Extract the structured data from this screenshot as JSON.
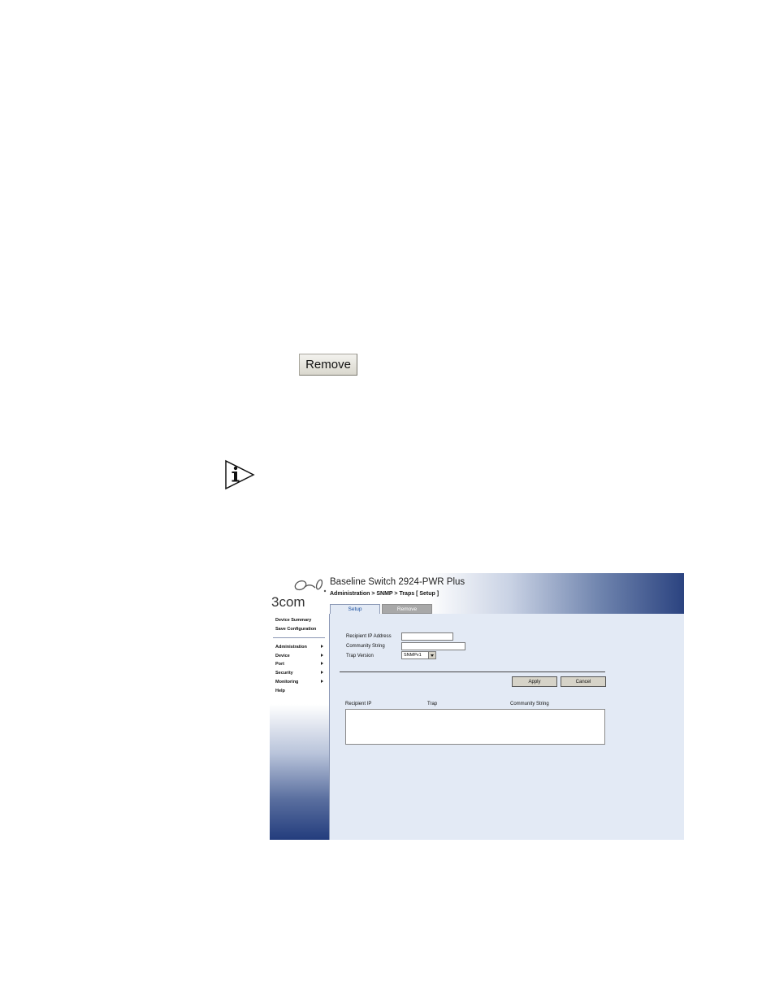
{
  "document": {
    "remove_button_label": "Remove"
  },
  "screenshot": {
    "logo_text": "3com",
    "app_title": "Baseline Switch 2924-PWR Plus",
    "breadcrumb": "Administration > SNMP > Traps [ Setup ]",
    "tabs": [
      {
        "label": "Setup",
        "active": true
      },
      {
        "label": "Remove",
        "active": false
      }
    ],
    "sidebar": {
      "top_links": [
        "Device Summary",
        "Save Configuration"
      ],
      "menu": [
        {
          "label": "Administration",
          "has_submenu": true
        },
        {
          "label": "Device",
          "has_submenu": true
        },
        {
          "label": "Port",
          "has_submenu": true
        },
        {
          "label": "Security",
          "has_submenu": true
        },
        {
          "label": "Monitoring",
          "has_submenu": true
        },
        {
          "label": "Help",
          "has_submenu": false
        }
      ]
    },
    "form": {
      "recipient_ip_label": "Recipient IP Address",
      "recipient_ip_value": "",
      "community_label": "Community String",
      "community_value": "",
      "trap_version_label": "Trap Version",
      "trap_version_value": "SNMPv1"
    },
    "buttons": {
      "apply": "Apply",
      "cancel": "Cancel"
    },
    "table": {
      "columns": [
        "Recipient IP",
        "Trap",
        "Community String"
      ],
      "rows": []
    },
    "colors": {
      "brand_navy": "#233d7d",
      "content_bg": "#e3eaf5",
      "active_tab_text": "#1a4fa0"
    }
  }
}
